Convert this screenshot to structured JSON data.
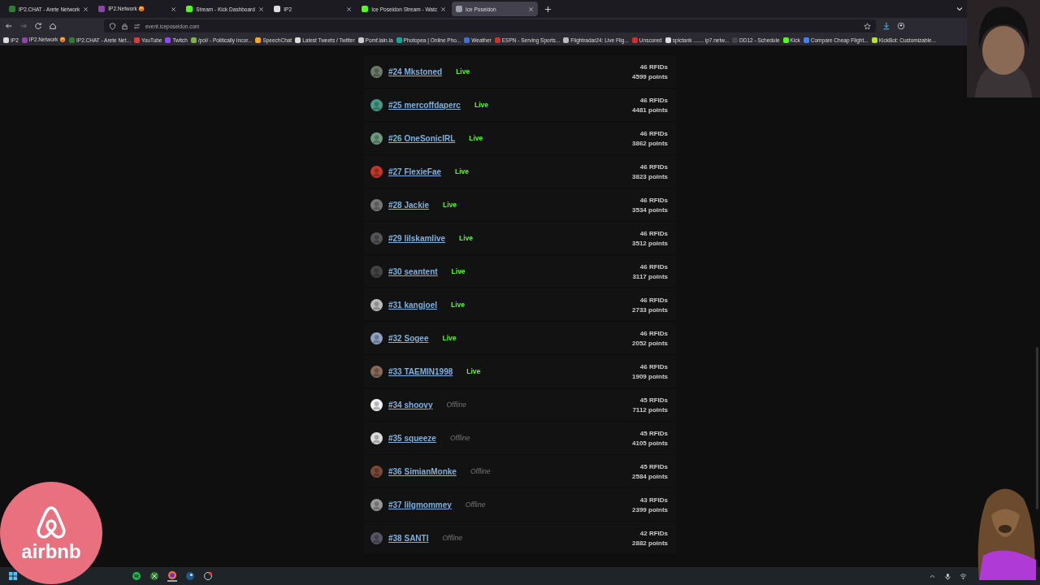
{
  "tabs": [
    {
      "label": "IP2.CHAT - Arete Network",
      "selected": false,
      "color": "#2e7d32"
    },
    {
      "label": "IP2.Network 😡",
      "selected": false,
      "color": "#8e44ad"
    },
    {
      "label": "Stream - Kick Dashboard",
      "selected": false,
      "color": "#53fc18"
    },
    {
      "label": "IP2",
      "selected": false,
      "color": "#dddddd"
    },
    {
      "label": "Ice Poseidon Stream - Watc",
      "selected": false,
      "color": "#53fc18"
    },
    {
      "label": "Ice Poseidon",
      "selected": true,
      "color": "#9aa0a6"
    }
  ],
  "address": "event.iceposeidon.com",
  "bookmarks": [
    {
      "label": "IP2",
      "color": "#dddddd"
    },
    {
      "label": "IP2.Network 😡",
      "color": "#8e44ad"
    },
    {
      "label": "IP2.CHAT - Arete Net...",
      "color": "#2e7d32"
    },
    {
      "label": "YouTube",
      "color": "#e53935"
    },
    {
      "label": "Twitch",
      "color": "#9146ff"
    },
    {
      "label": "/pol/ - Politically Incor...",
      "color": "#7cb342"
    },
    {
      "label": "SpeechChat",
      "color": "#f5a623"
    },
    {
      "label": "Latest Tweets / Twitter",
      "color": "#dddddd"
    },
    {
      "label": "Pomf.lain.la",
      "color": "#cccccc"
    },
    {
      "label": "Photopea | Online Pho...",
      "color": "#18a497"
    },
    {
      "label": "Weather",
      "color": "#3f6fd8"
    },
    {
      "label": "ESPN - Serving Sports...",
      "color": "#d32f2f"
    },
    {
      "label": "Flightradar24: Live Flig...",
      "color": "#bbbbbb"
    },
    {
      "label": "Unscored",
      "color": "#d32f2f"
    },
    {
      "label": "spictank ....... ip7.netw...",
      "color": "#dddddd"
    },
    {
      "label": "DD12 - Schedule",
      "color": "#444444"
    },
    {
      "label": "Kick",
      "color": "#53fc18"
    },
    {
      "label": "Compare Cheap Flight...",
      "color": "#3b82f6"
    },
    {
      "label": "KickBot: Customizable...",
      "color": "#b5e61d"
    }
  ],
  "rows": [
    {
      "name": "#24 Mkstoned",
      "status": "Live",
      "kind": "live",
      "rfids": "46 RFIDs",
      "points": "4599 points"
    },
    {
      "name": "#25 mercoffdaperc",
      "status": "Live",
      "kind": "live",
      "rfids": "46 RFIDs",
      "points": "4481 points"
    },
    {
      "name": "#26 OneSonicIRL",
      "status": "Live",
      "kind": "live",
      "rfids": "46 RFIDs",
      "points": "3862 points"
    },
    {
      "name": "#27 FlexieFae",
      "status": "Live",
      "kind": "live",
      "rfids": "46 RFIDs",
      "points": "3823 points"
    },
    {
      "name": "#28 Jackie",
      "status": "Live",
      "kind": "live",
      "rfids": "46 RFIDs",
      "points": "3534 points"
    },
    {
      "name": "#29 lilskamlive",
      "status": "Live",
      "kind": "live",
      "rfids": "46 RFIDs",
      "points": "3512 points"
    },
    {
      "name": "#30 seantent",
      "status": "Live",
      "kind": "live",
      "rfids": "46 RFIDs",
      "points": "3117 points"
    },
    {
      "name": "#31 kangjoel",
      "status": "Live",
      "kind": "live",
      "rfids": "46 RFIDs",
      "points": "2733 points"
    },
    {
      "name": "#32 Sogee",
      "status": "Live",
      "kind": "live",
      "rfids": "46 RFIDs",
      "points": "2052 points"
    },
    {
      "name": "#33 TAEMIN1998",
      "status": "Live",
      "kind": "live",
      "rfids": "46 RFIDs",
      "points": "1909 points"
    },
    {
      "name": "#34 shoovy",
      "status": "Offline",
      "kind": "offline",
      "rfids": "45 RFIDs",
      "points": "7112 points"
    },
    {
      "name": "#35 squeeze",
      "status": "Offline",
      "kind": "offline",
      "rfids": "45 RFIDs",
      "points": "4105 points"
    },
    {
      "name": "#36 SimianMonke",
      "status": "Offline",
      "kind": "offline",
      "rfids": "45 RFIDs",
      "points": "2584 points"
    },
    {
      "name": "#37 lilgmommey",
      "status": "Offline",
      "kind": "offline",
      "rfids": "43 RFIDs",
      "points": "2399 points"
    },
    {
      "name": "#38 SANTI",
      "status": "Offline",
      "kind": "offline",
      "rfids": "42 RFIDs",
      "points": "2882 points"
    }
  ],
  "ad_overlay": {
    "label": "airbnb"
  }
}
